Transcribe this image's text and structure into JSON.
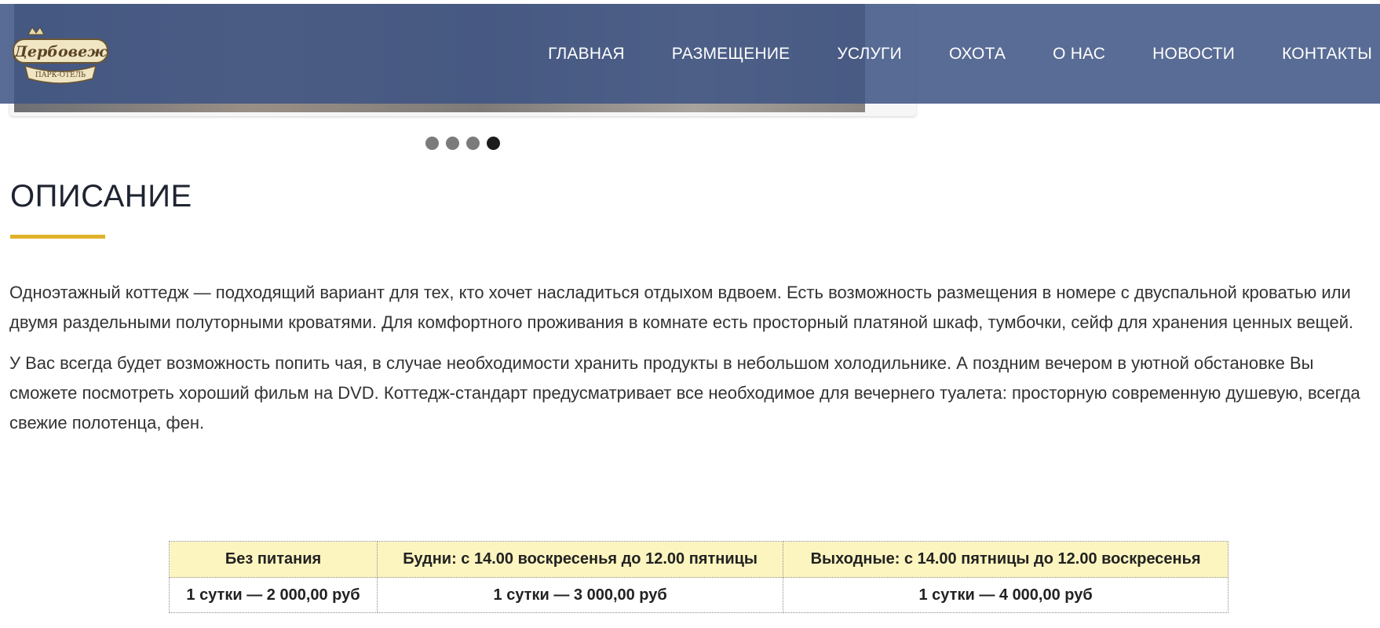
{
  "header": {
    "logo": {
      "name": "Дербовеж",
      "subtitle": "ПАРК-ОТЕЛЬ"
    },
    "nav": [
      {
        "label": "ГЛАВНАЯ"
      },
      {
        "label": "РАЗМЕЩЕНИЕ"
      },
      {
        "label": "УСЛУГИ"
      },
      {
        "label": "ОХОТА"
      },
      {
        "label": "О НАС"
      },
      {
        "label": "НОВОСТИ"
      },
      {
        "label": "КОНТАКТЫ"
      }
    ]
  },
  "slider": {
    "slide_count": 4,
    "active_index": 4
  },
  "section": {
    "heading": "ОПИСАНИЕ",
    "accent_color": "#e0b12a",
    "paragraphs": [
      "Одноэтажный коттедж — подходящий вариант для тех, кто хочет насладиться отдыхом вдвоем. Есть возможность размещения в номере с двуспальной кроватью или двумя раздельными полуторными кроватями. Для комфортного проживания в комнате есть просторный платяной шкаф, тумбочки, сейф для хранения ценных вещей.",
      "У Вас всегда будет возможность попить чая, в случае необходимости хранить продукты в небольшом холодильнике. А поздним вечером в уютной обстановке Вы сможете посмотреть хороший фильм на DVD. Коттедж-стандарт предусматривает все необходимое для вечернего туалета: просторную современную душевую, всегда свежие полотенца, фен."
    ]
  },
  "price_table": {
    "headers": [
      "Без питания",
      "Будни: с 14.00 воскресенья до 12.00 пятницы",
      "Выходные: с 14.00 пятницы до 12.00 воскресенья"
    ],
    "row": [
      "1 сутки — 2 000,00 руб",
      "1 сутки — 3 000,00 руб",
      "1 сутки — 4 000,00 руб"
    ],
    "header_bg": "#fdf5c0"
  },
  "colors": {
    "header_bg": "#3e5484",
    "accent": "#e0b12a"
  }
}
